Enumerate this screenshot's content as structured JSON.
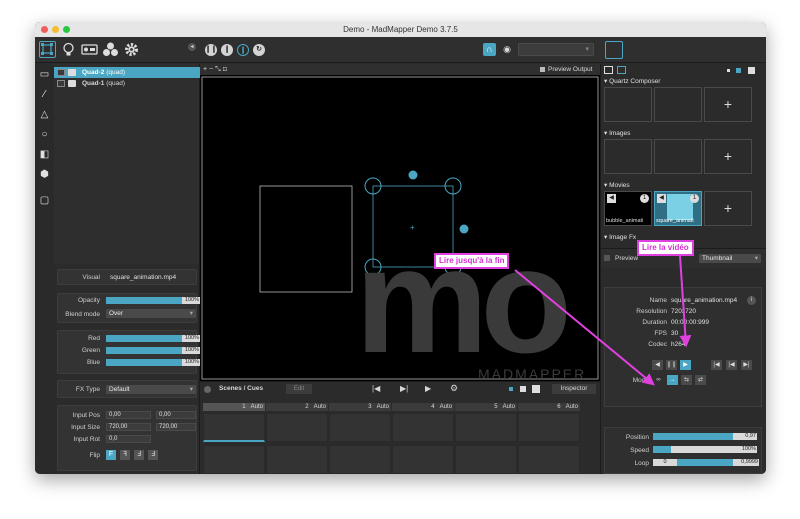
{
  "window": {
    "title": "Demo - MadMapper Demo 3.7.5"
  },
  "layers": [
    {
      "name": "Quad-2",
      "type": "(quad)",
      "selected": true
    },
    {
      "name": "Quad-1",
      "type": "(quad)",
      "selected": false
    }
  ],
  "canvas": {
    "toolbar_symbols": "+ − ⤡ ⊡",
    "preview_output_label": "Preview Output",
    "watermark_brand": "MADMAPPER",
    "watermark_logo": "mo"
  },
  "props": {
    "visual_label": "Visual",
    "visual_value": "square_animation.mp4",
    "opacity_label": "Opacity",
    "opacity_value": "100%",
    "blend_label": "Blend mode",
    "blend_value": "Over",
    "red_label": "Red",
    "red_value": "100%",
    "green_label": "Green",
    "green_value": "100%",
    "blue_label": "Blue",
    "blue_value": "100%",
    "fx_label": "FX Type",
    "fx_value": "Default",
    "input_pos_label": "Input Pos",
    "input_pos_x": "0,00",
    "input_pos_y": "0,00",
    "input_size_label": "Input Size",
    "input_size_w": "720,00",
    "input_size_h": "720,00",
    "input_rot_label": "Input Rot",
    "input_rot_value": "0,0",
    "flip_label": "Flip"
  },
  "scenes": {
    "title": "Scenes / Cues",
    "edit_label": "Edit",
    "inspector_label": "Inspector",
    "cues": [
      {
        "num": "1",
        "mode": "Auto"
      },
      {
        "num": "2",
        "mode": "Auto"
      },
      {
        "num": "3",
        "mode": "Auto"
      },
      {
        "num": "4",
        "mode": "Auto"
      },
      {
        "num": "5",
        "mode": "Auto"
      },
      {
        "num": "6",
        "mode": "Auto"
      }
    ]
  },
  "library": {
    "quartz_label": "Quartz Composer",
    "images_label": "Images",
    "movies_label": "Movies",
    "image_fx_label": "Image Fx",
    "movie1_name": "bubble_animati",
    "movie2_name": "square_animati",
    "movie_badge": "1"
  },
  "media": {
    "preview_label": "Preview",
    "thumbnail_label": "Thumbnail",
    "name_label": "Name",
    "name_value": "square_animation.mp4",
    "resolution_label": "Resolution",
    "resolution_value": "720x720",
    "duration_label": "Duration",
    "duration_value": "00:00:00:999",
    "fps_label": "FPS",
    "fps_value": "30",
    "codec_label": "Codec",
    "codec_value": "h264",
    "mode_label": "Mode",
    "position_label": "Position",
    "position_value": "0,97",
    "speed_label": "Speed",
    "speed_value": "100%",
    "loop_label": "Loop",
    "loop_start": "0",
    "loop_end": "0,9999"
  },
  "annotations": {
    "play_to_end": "Lire jusqu'à la fin",
    "play_video": "Lire la vidéo"
  },
  "colors": {
    "accent": "#4aa6c2",
    "annotation": "#e040e0",
    "selected_row": "#4aa6c2"
  }
}
